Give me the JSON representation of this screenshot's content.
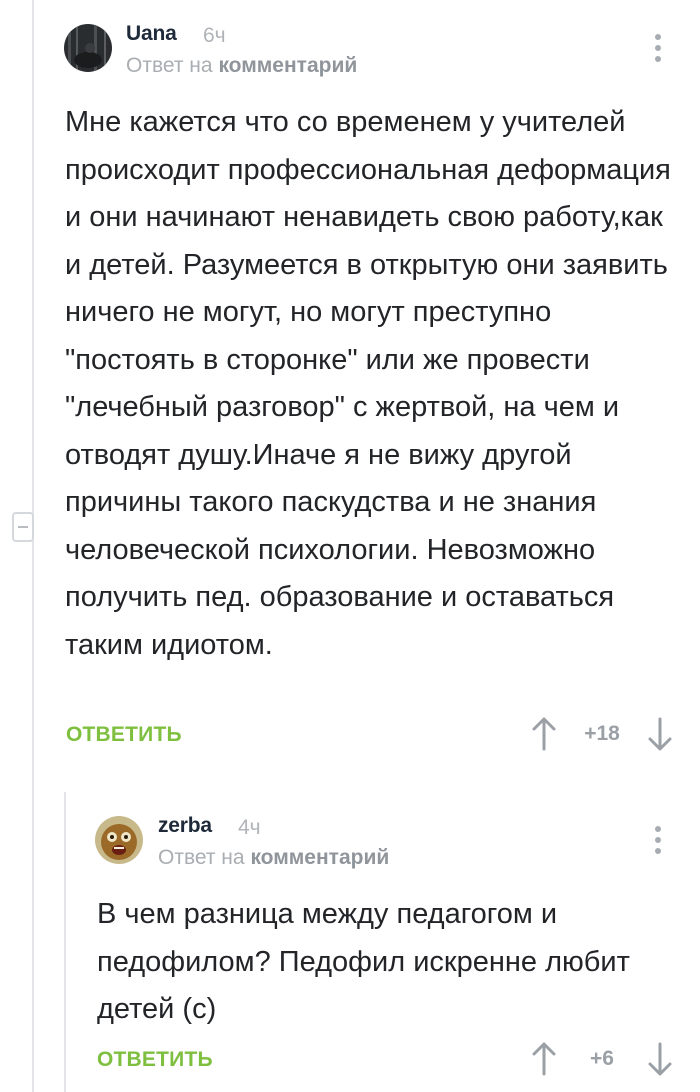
{
  "comments": [
    {
      "author": "Uana",
      "time": "6ч",
      "reply_prefix": "Ответ на",
      "reply_target": "комментарий",
      "text": "Мне кажется что со временем у учителей происходит профессиональная деформация и они начинают ненавидеть свою работу,как и детей. Разумеется в открытую они заявить ничего не могут, но могут преступно \"постоять в сторонке\" или же провести \"лечебный разговор\" с жертвой, на чем и отводят душу.Иначе я не вижу другой причины такого паскудства и не знания человеческой психологии. Невозможно получить пед. образование и оставаться таким идиотом.",
      "reply_label": "ОТВЕТИТЬ",
      "rating": "+18"
    },
    {
      "author": "zerba",
      "time": "4ч",
      "reply_prefix": "Ответ на",
      "reply_target": "комментарий",
      "text": "В чем разница между педагогом и педофилом? Педофил искренне любит детей (с)",
      "reply_label": "ОТВЕТИТЬ",
      "rating": "+6"
    }
  ],
  "colors": {
    "accent_green": "#7fbf3f",
    "muted": "#a9aeb3",
    "thread_line": "#e3e5e8"
  }
}
